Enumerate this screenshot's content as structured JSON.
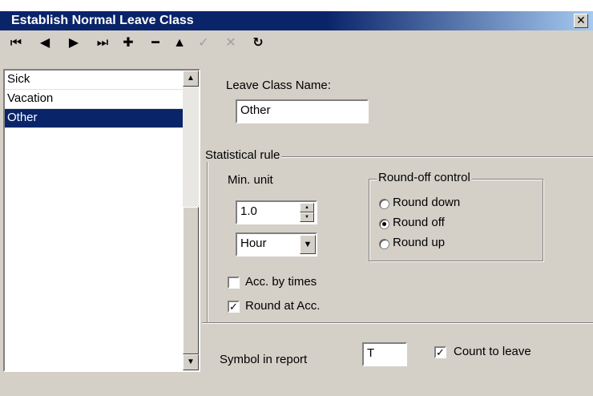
{
  "window": {
    "title": "Establish Normal Leave Class",
    "close_glyph": "✕"
  },
  "toolbar": {
    "first": "⏮",
    "prev": "◀",
    "next": "▶",
    "last": "⏭",
    "add": "✚",
    "remove": "━",
    "up": "▲",
    "confirm": "✓",
    "cancel": "✕",
    "refresh": "↻"
  },
  "list": {
    "items": [
      "Sick",
      "Vacation",
      "Other"
    ],
    "selected": "Other"
  },
  "form": {
    "name_label": "Leave Class Name:",
    "name_value": "Other",
    "stat_group": "Statistical rule",
    "min_unit_label": "Min. unit",
    "min_unit_value": "1.0",
    "unit_select": "Hour",
    "round_group": "Round-off control",
    "round_down": "Round down",
    "round_off": "Round off",
    "round_up": "Round up",
    "round_selected": "Round off",
    "acc_by_times": "Acc. by times",
    "acc_by_times_checked": false,
    "round_at_acc": "Round at Acc.",
    "round_at_acc_checked": true,
    "symbol_label": "Symbol in report",
    "symbol_value": "T",
    "count_label": "Count to leave",
    "count_checked": true
  },
  "colors": {
    "title_bar": "#0a246a",
    "face": "#d4d0c8",
    "selection": "#0a246a"
  },
  "icons": {
    "close": "close-icon",
    "scroll_up": "arrow-up-icon",
    "scroll_down": "arrow-down-icon"
  }
}
